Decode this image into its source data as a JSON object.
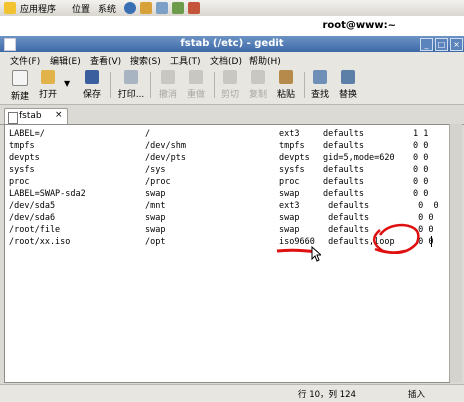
{
  "top_panel": {
    "menus": [
      "应用程序",
      "位置",
      "系统"
    ]
  },
  "bg_window": {
    "title": "root@www:~"
  },
  "window": {
    "title": "fstab (/etc) - gedit"
  },
  "menubar": [
    "文件(F)",
    "编辑(E)",
    "查看(V)",
    "搜索(S)",
    "工具(T)",
    "文档(D)",
    "帮助(H)"
  ],
  "toolbar": {
    "new": "新建",
    "open": "打开",
    "save": "保存",
    "print": "打印...",
    "undo": "撤消",
    "redo": "重做",
    "cut": "剪切",
    "copy": "复制",
    "paste": "粘贴",
    "find": "查找",
    "replace": "替换"
  },
  "tab": {
    "label": "fstab",
    "close": "×"
  },
  "editor": {
    "lines": [
      [
        "LABEL=/",
        "/",
        "ext3",
        "defaults",
        "1 1"
      ],
      [
        "tmpfs",
        "/dev/shm",
        "tmpfs",
        "defaults",
        "0 0"
      ],
      [
        "devpts",
        "/dev/pts",
        "devpts",
        "gid=5,mode=620",
        "0 0"
      ],
      [
        "sysfs",
        "/sys",
        "sysfs",
        "defaults",
        "0 0"
      ],
      [
        "proc",
        "/proc",
        "proc",
        "defaults",
        "0 0"
      ],
      [
        "LABEL=SWAP-sda2",
        "swap",
        "swap",
        "defaults",
        "0 0"
      ],
      [
        "/dev/sda5",
        "/mnt",
        "ext3",
        " defaults",
        " 0  0"
      ],
      [
        "/dev/sda6",
        "swap",
        "swap",
        " defaults",
        " 0 0"
      ],
      [
        "/root/file",
        "swap",
        "swap",
        " defaults",
        " 0 0"
      ],
      [
        "/root/xx.iso",
        "/opt",
        "iso9660",
        " defaults,loop",
        " 0 0"
      ]
    ]
  },
  "status": {
    "position": "行 10，列 124",
    "mode": "插入"
  },
  "colors": {
    "titlebar": "#3d69a8",
    "annotation": "#e01010"
  }
}
